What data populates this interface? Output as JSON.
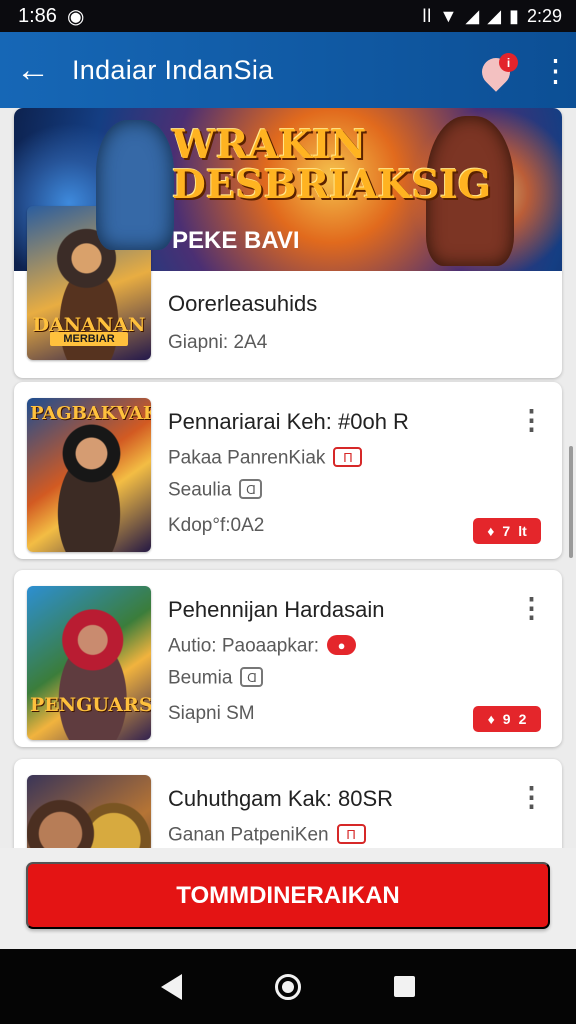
{
  "status_bar": {
    "time": "1:86",
    "icons": [
      "notification-icon",
      "vibrate-icon",
      "wifi-icon",
      "signal-icon",
      "signal-icon",
      "battery-icon"
    ],
    "right_text": "2:29"
  },
  "app_bar": {
    "back_icon": "←",
    "title": "Indaiar IndanSia",
    "notification_badge": "i",
    "menu_icon": "⋮"
  },
  "featured": {
    "banner_title": "WRAKIN DESBRIAKSIG",
    "banner_subtitle": "PEKE BAVI",
    "thumbnail_title": "DANANAN",
    "thumbnail_subtitle": "MERBIAR",
    "title": "Oorerleasuhids",
    "meta": "Giapni: 2A4"
  },
  "games": [
    {
      "thumbnail_title": "PAGBAKVAK",
      "title": "Pennariarai Keh: #0oh R",
      "line1": "Pakaa PanrenKiak",
      "line1_badge": "Π",
      "line2": "Seaulia",
      "line2_badge": "Ɑ",
      "line3": "Kdop°f:0A2",
      "rating": [
        "♦",
        "7",
        "lt"
      ]
    },
    {
      "thumbnail_title": "PENGUARS",
      "title": "Pehennijan Hardasain",
      "line1": "Autio: Paoaapkar:",
      "line1_badge": "●",
      "line2": "Beumia",
      "line2_badge": "Ɑ",
      "line3": "Siapni SM",
      "rating": [
        "♦",
        "9",
        "2"
      ]
    },
    {
      "title": "Cuhuthgam Kak: 80SR",
      "line1": "Ganan PatpeniKen",
      "line1_badge": "Π"
    }
  ],
  "cta": {
    "label": "TOMMDINERAIKAN"
  },
  "colors": {
    "primary": "#1667b6",
    "accent": "#e41414",
    "background": "#ececec"
  }
}
